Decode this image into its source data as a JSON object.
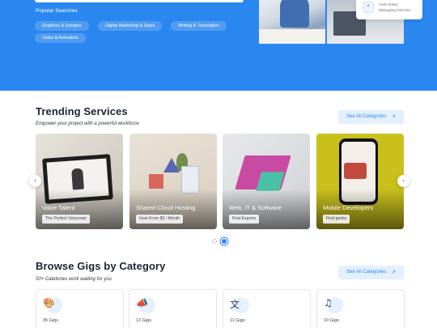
{
  "hero": {
    "popular_label": "Popular Searches",
    "chips": [
      "Graphics & Designs",
      "Digital Marketing & Sales",
      "Writing & Translation",
      "Video & Animation"
    ],
    "quote_name": "Asim Patra",
    "quote_role": "Managing Director"
  },
  "trending": {
    "title": "Trending Services",
    "subtitle": "Empower your project with a powerful workforce",
    "see_all": "See All Categories",
    "cards": [
      {
        "title": "Voice Talent",
        "tag": "The Perfect Voiceover"
      },
      {
        "title": "Shared Cloud Hosting",
        "tag": "Host From $5 / Month"
      },
      {
        "title": "Web, IT & Software",
        "tag": "Find Experts"
      },
      {
        "title": "Mobile Developers",
        "tag": "Find geeks"
      }
    ],
    "prev_icon": "‹",
    "next_icon": "›"
  },
  "browse": {
    "title": "Browse Gigs by Category",
    "subtitle": "50+ Catetories work waiting for you",
    "see_all": "See All Categories",
    "categories": [
      {
        "icon": "palette-icon",
        "glyph": "🎨",
        "count": "35 Gigs"
      },
      {
        "icon": "megaphone-icon",
        "glyph": "📣",
        "count": "12 Gigs"
      },
      {
        "icon": "translate-icon",
        "glyph": "文",
        "count": "11 Gigs"
      },
      {
        "icon": "music-note-icon",
        "glyph": "♫",
        "count": "10 Gigs"
      }
    ]
  },
  "colors": {
    "brand_blue": "#2b87f0",
    "see_all_bg": "#e4f0ff",
    "heading": "#1b2433"
  },
  "icons": {
    "arrow": "↗"
  }
}
